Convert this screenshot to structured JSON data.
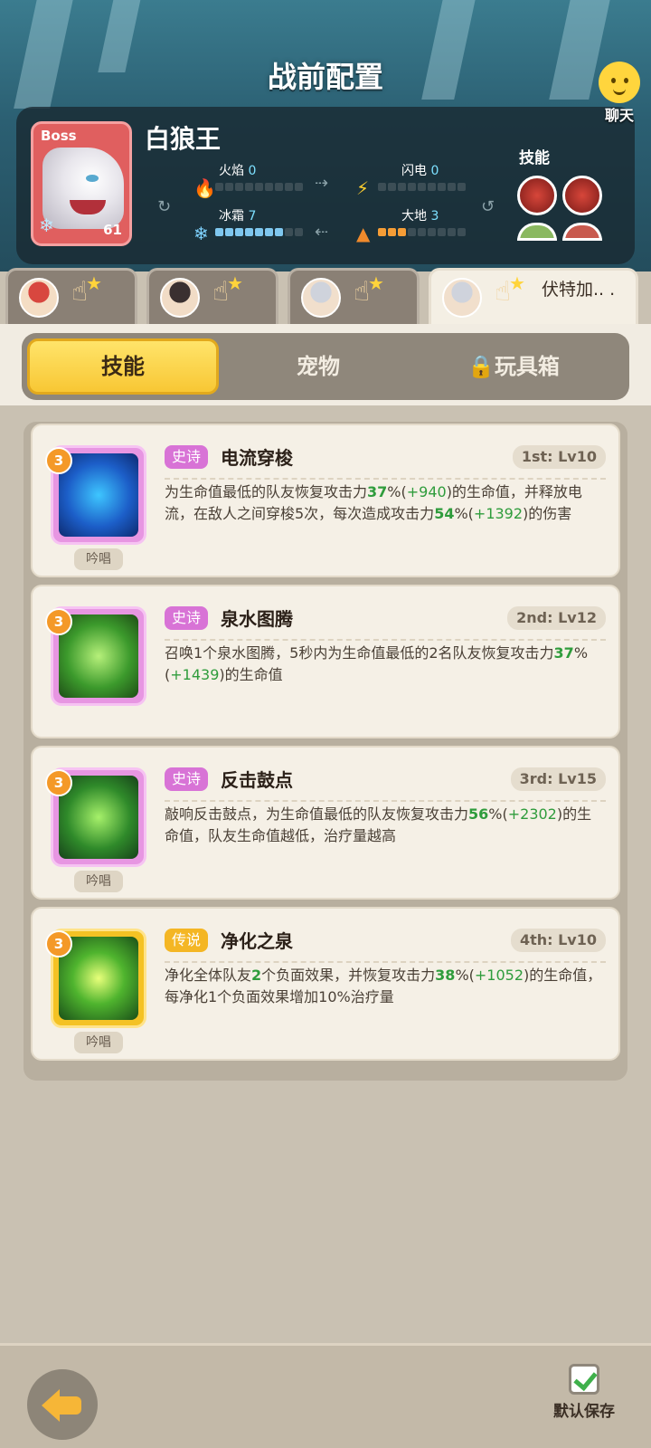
{
  "header": {
    "title": "战前配置"
  },
  "boss": {
    "tag": "Boss",
    "name": "白狼王",
    "level": "61",
    "stats": [
      {
        "label": "火焰",
        "value": "0",
        "icon": "fire-icon",
        "fill": 0
      },
      {
        "label": "闪电",
        "value": "0",
        "icon": "lightning-icon",
        "fill": 0
      },
      {
        "label": "冰霜",
        "value": "7",
        "icon": "frost-icon",
        "fill": 7
      },
      {
        "label": "大地",
        "value": "3",
        "icon": "earth-icon",
        "fill": 3
      }
    ],
    "skills_label": "技能"
  },
  "chat": {
    "label": "聊天"
  },
  "heroes": [
    {
      "name": ""
    },
    {
      "name": ""
    },
    {
      "name": ""
    },
    {
      "name": "伏特加.. ."
    }
  ],
  "tabs": [
    {
      "label": "技能",
      "active": true
    },
    {
      "label": "宠物",
      "active": false
    },
    {
      "label": "玩具箱",
      "active": false,
      "locked": true
    }
  ],
  "skills": [
    {
      "badge": "3",
      "rarity": "史诗",
      "name": "电流穿梭",
      "level": "1st: Lv10",
      "chant": "吟唱",
      "desc_parts": [
        "为生命值最低的队友恢复攻击力",
        "37",
        "%(",
        "+940",
        ")的生命值，并释放电流，在敌人之间穿梭5次，每次造成攻击力",
        "54",
        "%(",
        "+1392",
        ")的伤害"
      ]
    },
    {
      "badge": "3",
      "rarity": "史诗",
      "name": "泉水图腾",
      "level": "2nd: Lv12",
      "chant": "",
      "desc_parts": [
        "召唤1个泉水图腾，5秒内为生命值最低的2名队友恢复攻击力",
        "37",
        "%(",
        "+1439",
        ")的生命值"
      ]
    },
    {
      "badge": "3",
      "rarity": "史诗",
      "name": "反击鼓点",
      "level": "3rd: Lv15",
      "chant": "吟唱",
      "desc_parts": [
        "敲响反击鼓点，为生命值最低的队友恢复攻击力",
        "56",
        "%(",
        "+2302",
        ")的生命值，队友生命值越低，治疗量越高"
      ]
    },
    {
      "badge": "3",
      "rarity": "传说",
      "name": "净化之泉",
      "level": "4th: Lv10",
      "chant": "吟唱",
      "desc_parts": [
        "净化全体队友",
        "2",
        "个负面效果，并恢复攻击力",
        "38",
        "%(",
        "+1052",
        ")的生命值，每净化1个负面效果增加10%治疗量"
      ]
    }
  ],
  "footer": {
    "save_label": "默认保存"
  }
}
